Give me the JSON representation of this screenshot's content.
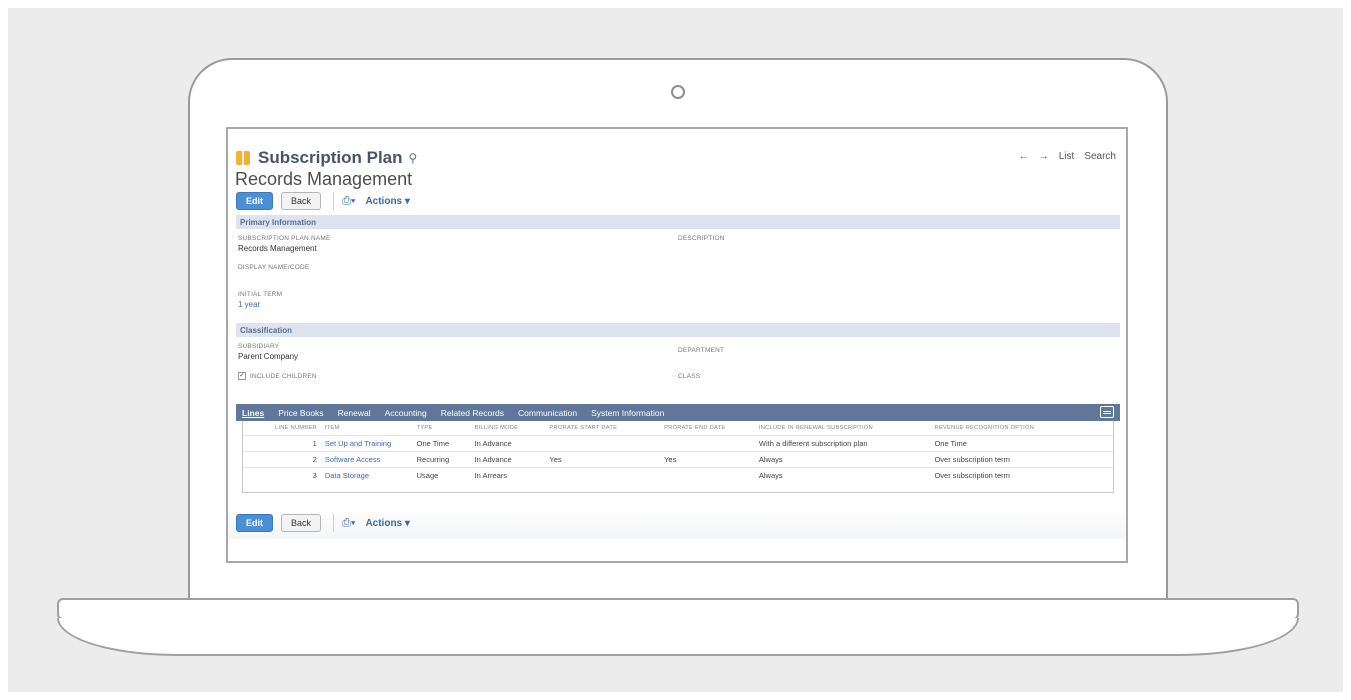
{
  "header": {
    "record_type": "Subscription Plan",
    "record_name": "Records Management",
    "nav": {
      "back_arrow": "←",
      "forward_arrow": "→",
      "list": "List",
      "search": "Search"
    }
  },
  "toolbar": {
    "edit": "Edit",
    "back": "Back",
    "actions": "Actions ▾",
    "print_icon": "⎙▾"
  },
  "primary": {
    "title": "Primary Information",
    "plan_name_label": "SUBSCRIPTION PLAN NAME",
    "plan_name_value": "Records Management",
    "display_name_label": "DISPLAY NAME/CODE",
    "initial_term_label": "INITIAL TERM",
    "initial_term_value": "1 year",
    "description_label": "DESCRIPTION"
  },
  "classification": {
    "title": "Classification",
    "subsidiary_label": "SUBSIDIARY",
    "subsidiary_value": "Parent Company",
    "include_children_label": "INCLUDE CHILDREN",
    "department_label": "DEPARTMENT",
    "class_label": "CLASS"
  },
  "tabs": [
    "Lines",
    "Price Books",
    "Renewal",
    "Accounting",
    "Related Records",
    "Communication",
    "System Information"
  ],
  "lines": {
    "columns": [
      "LINE NUMBER",
      "ITEM",
      "TYPE",
      "BILLING MODE",
      "PRORATE START DATE",
      "PRORATE END DATE",
      "INCLUDE IN RENEWAL SUBSCRIPTION",
      "REVENUE RECOGNITION OPTION"
    ],
    "rows": [
      [
        "1",
        "Set Up and Training",
        "One Time",
        "In Advance",
        "",
        "",
        "With a different subscription plan",
        "One Time"
      ],
      [
        "2",
        "Software Access",
        "Recurring",
        "In Advance",
        "Yes",
        "Yes",
        "Always",
        "Over subscription term"
      ],
      [
        "3",
        "Data Storage",
        "Usage",
        "In Arrears",
        "",
        "",
        "Always",
        "Over subscription term"
      ]
    ]
  },
  "colors": {
    "section_bg": "#dde4ef",
    "tabbar_bg": "#607799",
    "primary_button": "#4d8fd4",
    "link": "#3c6cb5",
    "record_icon": "#f2b233"
  }
}
